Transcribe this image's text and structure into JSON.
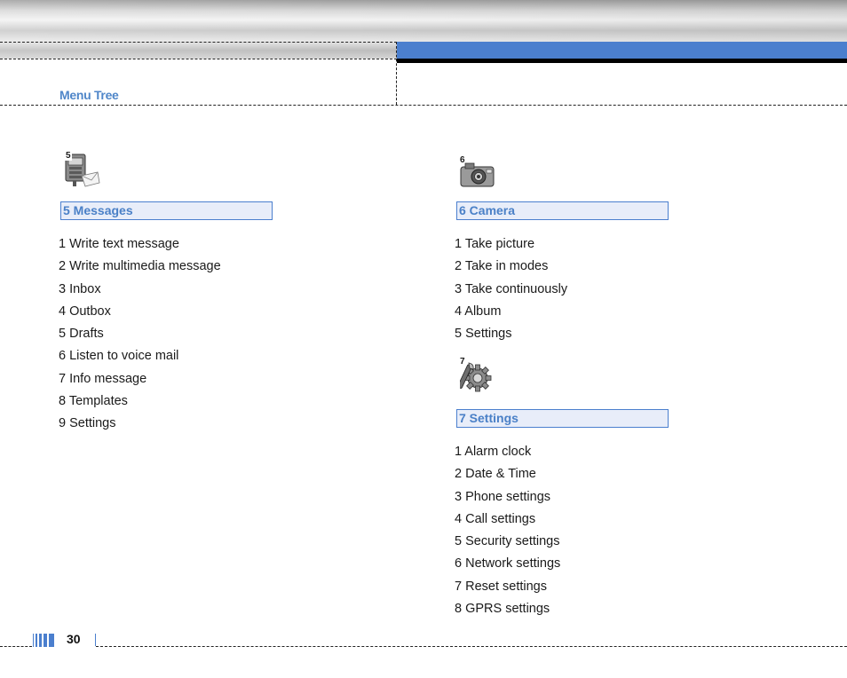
{
  "header": {
    "section_title": "Menu Tree"
  },
  "columns": [
    {
      "icon_number": "5",
      "icon_name": "messages-icon",
      "title": "5 Messages",
      "items": [
        "1 Write text message",
        "2 Write multimedia message",
        "3 Inbox",
        "4 Outbox",
        "5 Drafts",
        "6 Listen to voice mail",
        "7 Info message",
        "8 Templates",
        "9 Settings"
      ]
    },
    {
      "icon_number": "6",
      "icon_name": "camera-icon",
      "title": "6 Camera",
      "items": [
        "1 Take picture",
        "2 Take in modes",
        "3 Take continuously",
        "4 Album",
        "5 Settings"
      ]
    },
    {
      "icon_number": "7",
      "icon_name": "settings-gear-icon",
      "title": "7 Settings",
      "items": [
        "1 Alarm clock",
        "2 Date & Time",
        "3 Phone settings",
        "4 Call settings",
        "5 Security settings",
        "6 Network settings",
        "7 Reset settings",
        "8 GPRS settings"
      ]
    }
  ],
  "footer": {
    "page_number": "30"
  },
  "colors": {
    "accent_blue": "#4b7fce",
    "title_blue": "#4f86c9",
    "header_fill": "#e8edf9"
  }
}
